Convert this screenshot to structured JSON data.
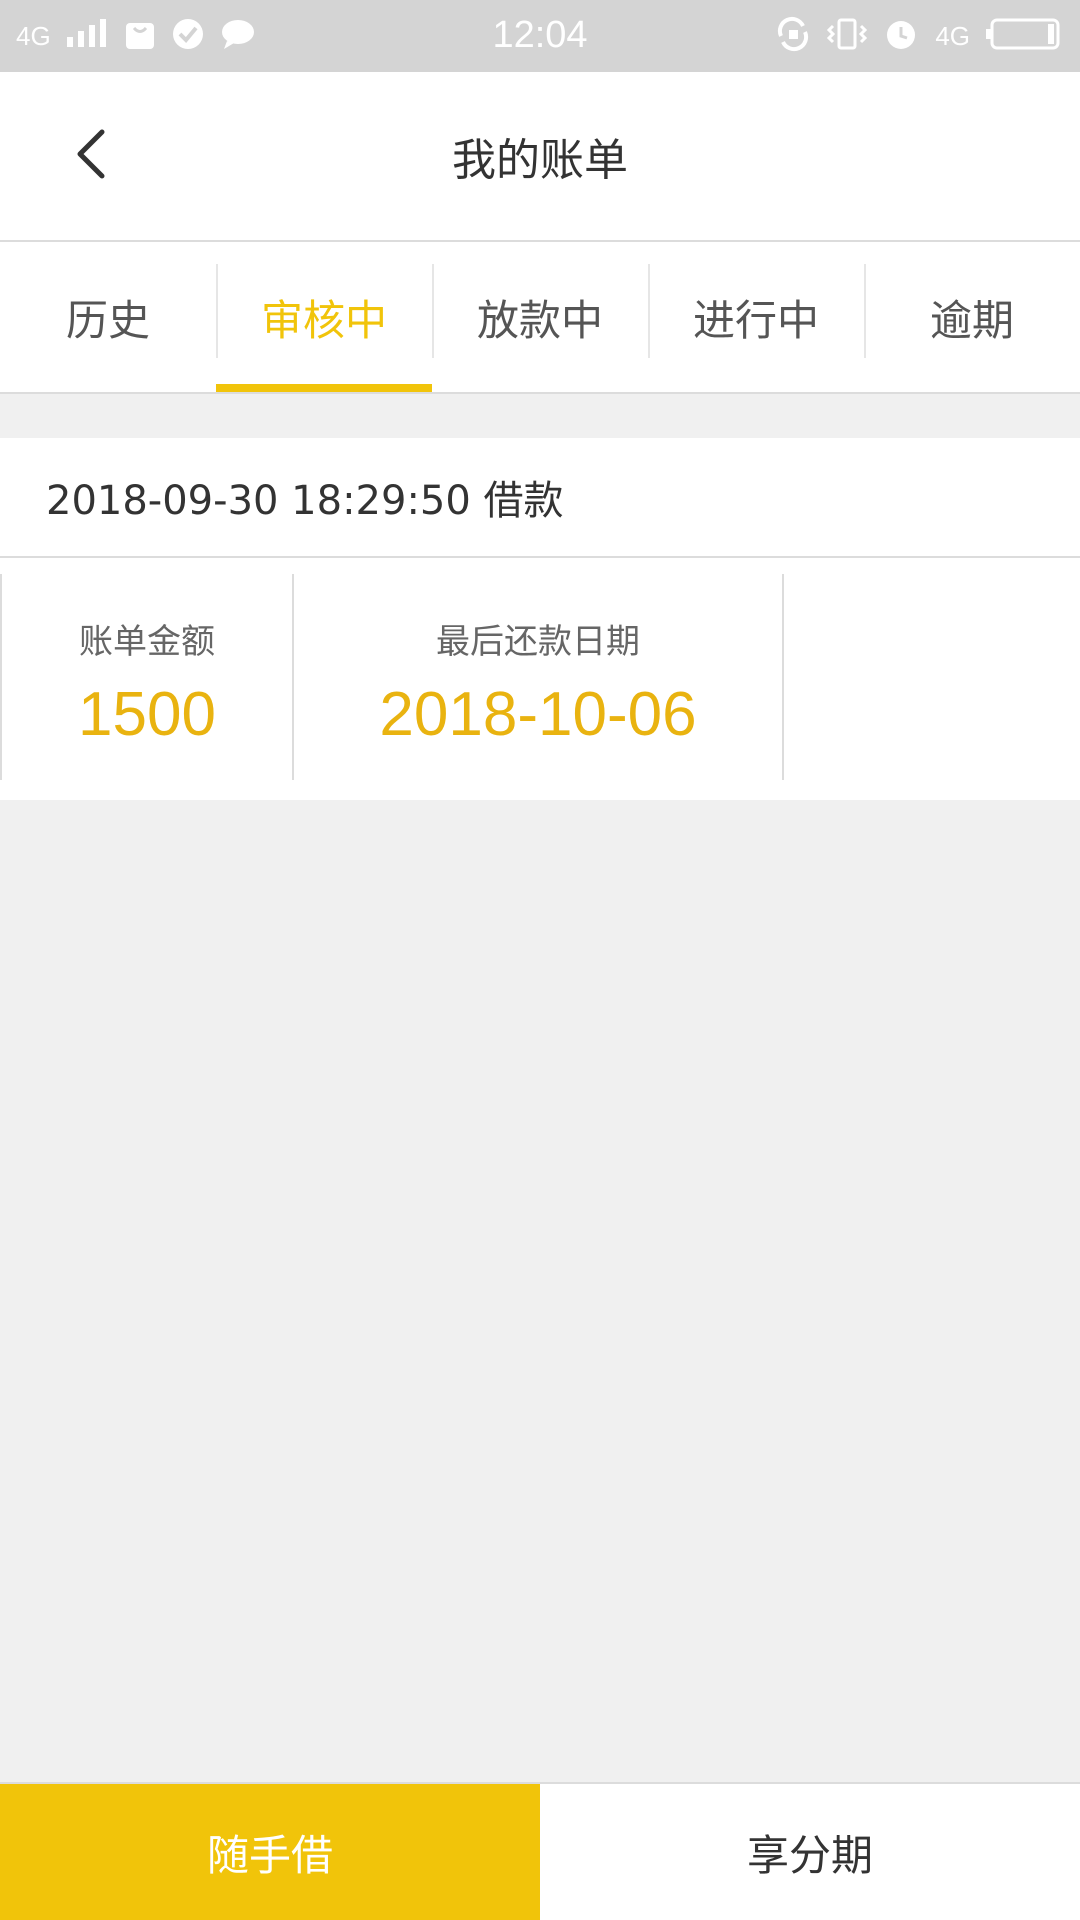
{
  "status_bar": {
    "network": "4G",
    "network_right": "4G",
    "time": "12:04"
  },
  "header": {
    "title": "我的账单"
  },
  "tabs": [
    {
      "label": "历史",
      "active": false
    },
    {
      "label": "审核中",
      "active": true
    },
    {
      "label": "放款中",
      "active": false
    },
    {
      "label": "进行中",
      "active": false
    },
    {
      "label": "逾期",
      "active": false
    }
  ],
  "bill": {
    "header_text": "2018-09-30 18:29:50 借款",
    "amount_label": "账单金额",
    "amount_value": "1500",
    "due_label": "最后还款日期",
    "due_value": "2018-10-06"
  },
  "bottom": {
    "borrow_label": "随手借",
    "installment_label": "享分期"
  },
  "colors": {
    "accent": "#f1c40a",
    "value": "#e9b310",
    "background": "#f0f0f0"
  }
}
